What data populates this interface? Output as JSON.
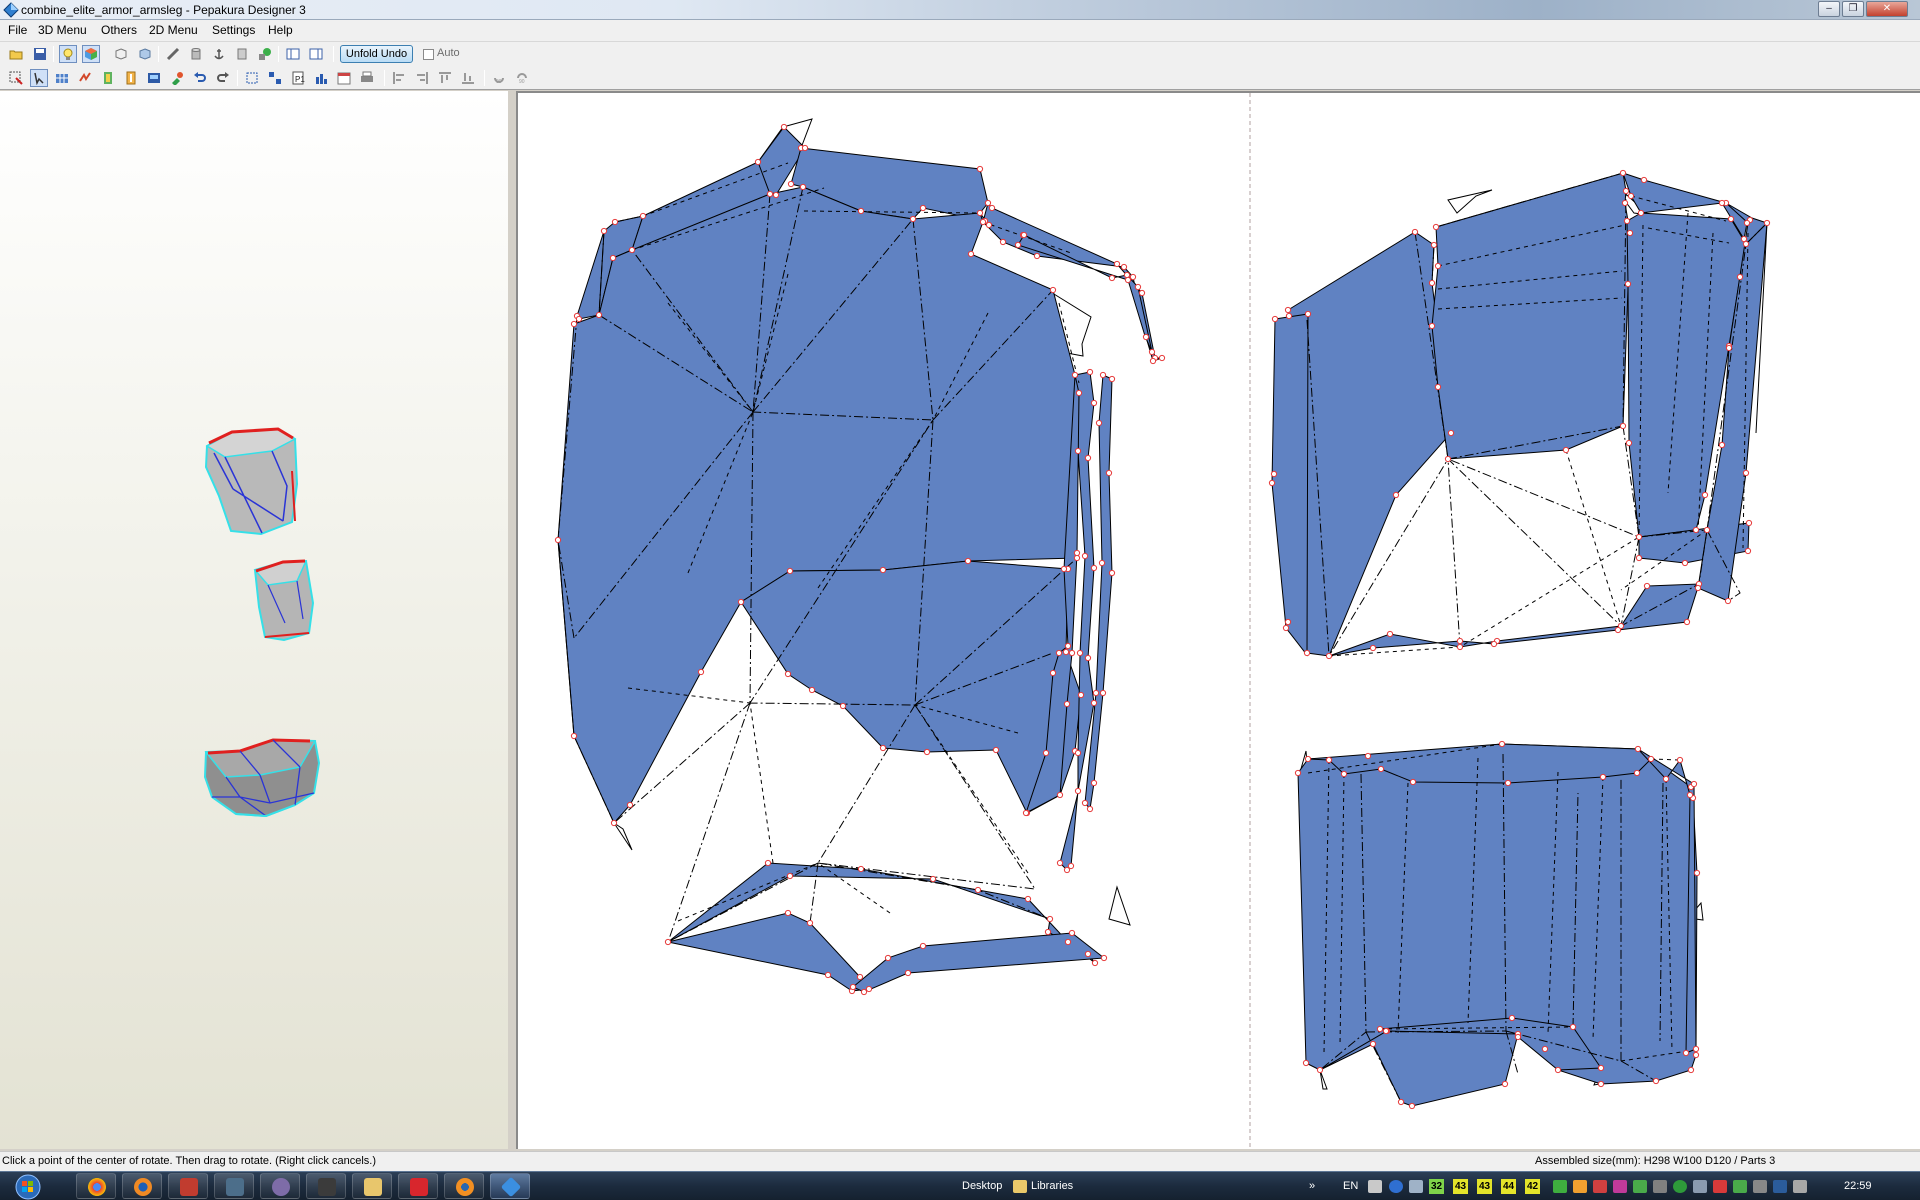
{
  "window": {
    "title": "combine_elite_armor_armsleg - Pepakura Designer 3",
    "controls": [
      "–",
      "❐",
      "✕"
    ]
  },
  "menu": [
    "File",
    "3D Menu",
    "Others",
    "2D Menu",
    "Settings",
    "Help"
  ],
  "toolbar": {
    "unfold_undo_label": "Unfold Undo",
    "auto_label": "Auto"
  },
  "status": {
    "left": "Click a point of the center of rotate. Then drag to rotate. (Right click cancels.)",
    "right": "Assembled size(mm): H298 W100 D120 / Parts 3"
  },
  "colors": {
    "part_fill": "#6082c2",
    "vertex": "#e63b3b",
    "edge_3d_cut": "#e0201f",
    "edge_3d_fold": "#2a34d6",
    "edge_3d_outline": "#35e0e8"
  },
  "taskbar": {
    "desktop_label": "Desktop",
    "libraries_label": "Libraries",
    "language": "EN",
    "tray_numbers": [
      "32",
      "43",
      "43",
      "44",
      "42"
    ],
    "clock": "22:59"
  }
}
